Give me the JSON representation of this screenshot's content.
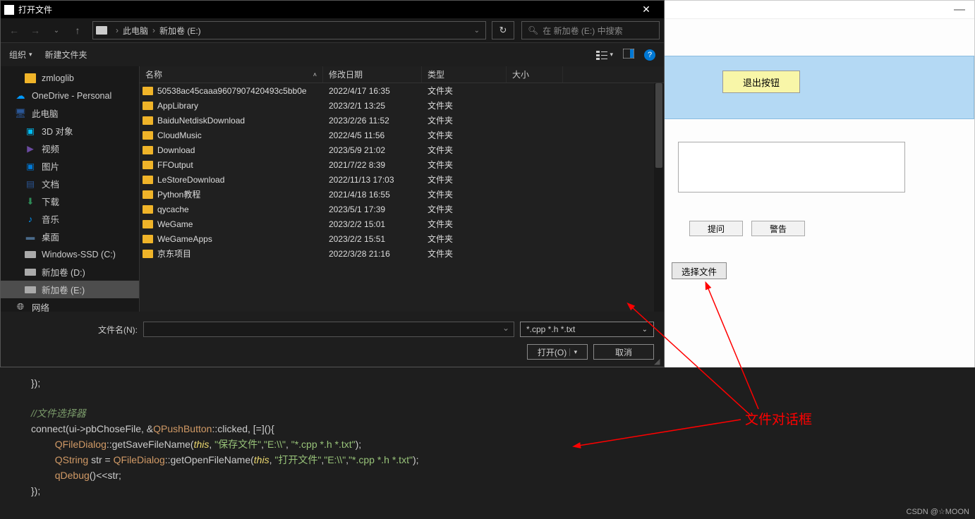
{
  "dialog": {
    "title": "打开文件",
    "nav": {
      "back": "←",
      "forward": "→",
      "up": "↑"
    },
    "breadcrumb": {
      "pc": "此电脑",
      "drive": "新加卷 (E:)"
    },
    "refresh": "↻",
    "search_placeholder": "在 新加卷 (E:) 中搜索",
    "toolbar": {
      "organize": "组织",
      "newfolder": "新建文件夹",
      "help": "?"
    },
    "columns": {
      "name": "名称",
      "date": "修改日期",
      "type": "类型",
      "size": "大小"
    },
    "sidebar": [
      {
        "label": "zmloglib",
        "icon": "folder",
        "indent": true
      },
      {
        "label": "OneDrive - Personal",
        "icon": "cloud"
      },
      {
        "label": "此电脑",
        "icon": "pc"
      },
      {
        "label": "3D 对象",
        "icon": "3d",
        "indent": true
      },
      {
        "label": "视频",
        "icon": "video",
        "indent": true
      },
      {
        "label": "图片",
        "icon": "pic",
        "indent": true
      },
      {
        "label": "文档",
        "icon": "doc",
        "indent": true
      },
      {
        "label": "下载",
        "icon": "dl",
        "indent": true
      },
      {
        "label": "音乐",
        "icon": "music",
        "indent": true
      },
      {
        "label": "桌面",
        "icon": "desk",
        "indent": true
      },
      {
        "label": "Windows-SSD (C:)",
        "icon": "drive",
        "indent": true
      },
      {
        "label": "新加卷 (D:)",
        "icon": "drive",
        "indent": true
      },
      {
        "label": "新加卷 (E:)",
        "icon": "drive",
        "indent": true,
        "selected": true
      },
      {
        "label": "网络",
        "icon": "net"
      }
    ],
    "files": [
      {
        "name": "50538ac45caaa9607907420493c5bb0e",
        "date": "2022/4/17 16:35",
        "type": "文件夹"
      },
      {
        "name": "AppLibrary",
        "date": "2023/2/1 13:25",
        "type": "文件夹"
      },
      {
        "name": "BaiduNetdiskDownload",
        "date": "2023/2/26 11:52",
        "type": "文件夹"
      },
      {
        "name": "CloudMusic",
        "date": "2022/4/5 11:56",
        "type": "文件夹"
      },
      {
        "name": "Download",
        "date": "2023/5/9 21:02",
        "type": "文件夹"
      },
      {
        "name": "FFOutput",
        "date": "2021/7/22 8:39",
        "type": "文件夹"
      },
      {
        "name": "LeStoreDownload",
        "date": "2022/11/13 17:03",
        "type": "文件夹"
      },
      {
        "name": "Python教程",
        "date": "2021/4/18 16:55",
        "type": "文件夹"
      },
      {
        "name": "qycache",
        "date": "2023/5/1 17:39",
        "type": "文件夹"
      },
      {
        "name": "WeGame",
        "date": "2023/2/2 15:01",
        "type": "文件夹"
      },
      {
        "name": "WeGameApps",
        "date": "2023/2/2 15:51",
        "type": "文件夹"
      },
      {
        "name": "京东项目",
        "date": "2022/3/28 21:16",
        "type": "文件夹"
      }
    ],
    "filename_label": "文件名(N):",
    "filter": "*.cpp *.h *.txt",
    "open_btn": "打开(O)",
    "cancel_btn": "取消"
  },
  "app": {
    "exit_btn": "退出按钮",
    "btn1": "提问",
    "btn2": "警告",
    "choose_file": "选择文件"
  },
  "annotation": {
    "label": "文件对话框"
  },
  "code": {
    "l1": "});",
    "l2": "//文件选择器",
    "l3a": "connect(ui->pbChoseFile, &",
    "l3b": "QPushButton",
    "l3c": "::clicked, [=](){",
    "l4a": "QFileDialog",
    "l4b": "::getSaveFileName(",
    "l4c": "this",
    "l4d": ", ",
    "l4e": "\"保存文件\"",
    "l4f": ",",
    "l4g": "\"E:\\\\\"",
    "l4h": ", ",
    "l4i": "\"*.cpp *.h *.txt\"",
    "l4j": ");",
    "l5a": "QString",
    "l5b": " str = ",
    "l5c": "QFileDialog",
    "l5d": "::getOpenFileName(",
    "l5e": "this",
    "l5f": ", ",
    "l5g": "\"打开文件\"",
    "l5h": ",",
    "l5i": "\"E:\\\\\"",
    "l5j": ",",
    "l5k": "\"*.cpp *.h *.txt\"",
    "l5l": ");",
    "l6a": "qDebug",
    "l6b": "()<<str;",
    "l7": "});"
  },
  "watermark": "CSDN @☆MOON"
}
